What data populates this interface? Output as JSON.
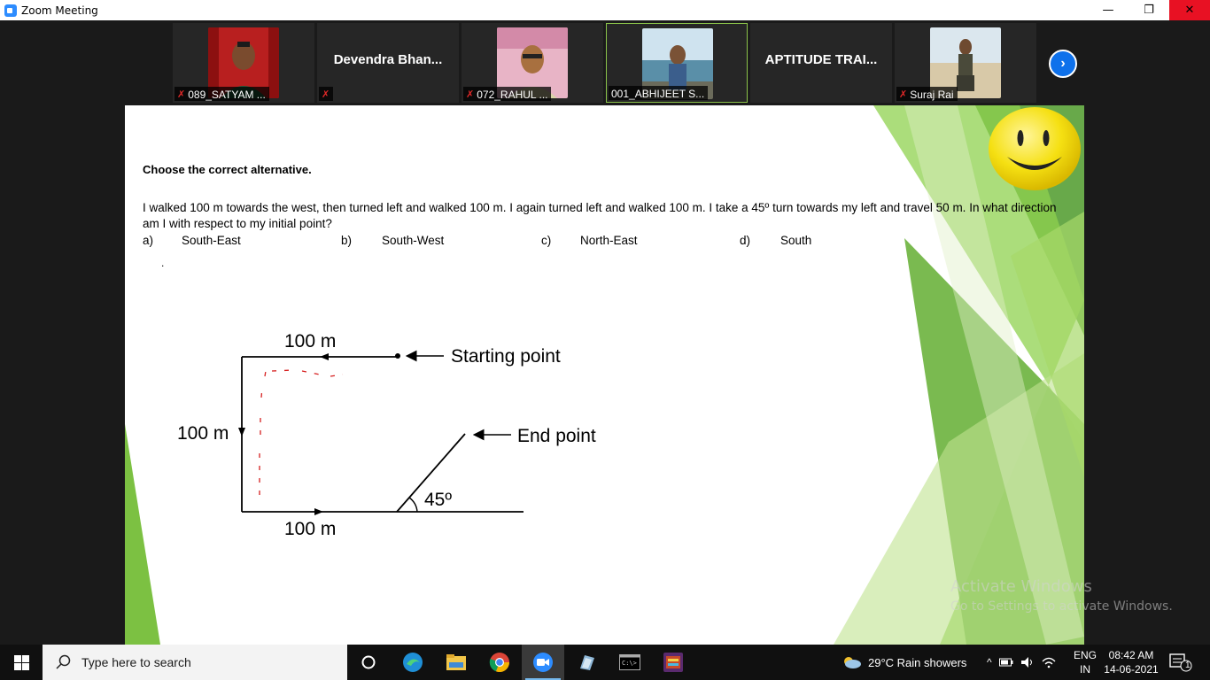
{
  "window": {
    "title": "Zoom Meeting",
    "minimize": "—",
    "maximize": "❐",
    "close": "✕"
  },
  "participants": [
    {
      "label": "089_SATYAM ...",
      "muted": true,
      "has_photo": true
    },
    {
      "name": "Devendra  Bhan...",
      "muted": true,
      "has_photo": false
    },
    {
      "label": "072_RAHUL ...",
      "muted": true,
      "has_photo": true
    },
    {
      "label": "001_ABHIJEET S...",
      "muted": false,
      "has_photo": true,
      "active": true
    },
    {
      "name": "APTITUDE TRAI...",
      "muted": false,
      "has_photo": false
    },
    {
      "label": "Suraj Rai",
      "muted": true,
      "has_photo": true
    }
  ],
  "slide": {
    "heading": "Choose the correct alternative.",
    "question": "I walked 100 m towards the west, then turned left and walked 100 m. I again turned left and walked 100 m. I take a 45º turn towards my left and travel 50 m. In what direction am I  with respect to my initial point?",
    "options": [
      {
        "key": "a)",
        "text": "South-East"
      },
      {
        "key": "b)",
        "text": "South-West"
      },
      {
        "key": "c)",
        "text": "North-East"
      },
      {
        "key": "d)",
        "text": "South"
      }
    ],
    "dot": ".",
    "diagram": {
      "top_label": "100 m",
      "left_label": "100 m",
      "bottom_label": "100 m",
      "start_label": "Starting point",
      "end_label": "End point",
      "angle_label": "45º"
    },
    "colors": {
      "accent_green": "#7cc142",
      "dark_green": "#4e9a2a"
    }
  },
  "watermark": {
    "line1": "Activate Windows",
    "line2": "Go to Settings to activate Windows."
  },
  "taskbar": {
    "search_placeholder": "Type here to search",
    "apps": [
      "task-view-icon",
      "edge-icon",
      "file-explorer-icon",
      "chrome-icon",
      "zoom-icon",
      "notes-icon",
      "terminal-icon",
      "game-icon"
    ],
    "weather": "29°C  Rain showers",
    "lang_top": "ENG",
    "lang_bottom": "IN",
    "time": "08:42 AM",
    "date": "14-06-2021",
    "notification_count": "1"
  }
}
